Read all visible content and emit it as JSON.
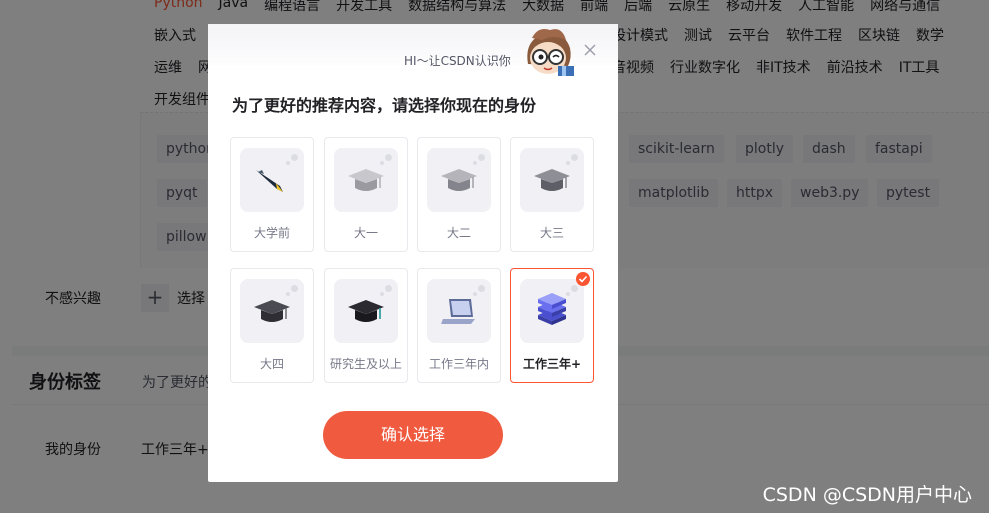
{
  "background": {
    "category_rows": [
      [
        "Python",
        "Java",
        "编程语言",
        "开发工具",
        "数据结构与算法",
        "大数据",
        "前端",
        "后端",
        "云原生",
        "移动开发",
        "人工智能",
        "网络与通信"
      ],
      [
        "嵌入式",
        "设计模式",
        "测试",
        "云平台",
        "软件工程",
        "区块链",
        "数学"
      ],
      [
        "运维",
        "网",
        "音视频",
        "行业数字化",
        "非IT技术",
        "前沿技术",
        "IT工具"
      ],
      [
        "开发组件"
      ]
    ],
    "tags_row1": [
      "python",
      "scikit-learn",
      "plotly",
      "dash",
      "fastapi"
    ],
    "tags_row2": [
      "pyqt",
      "matplotlib",
      "httpx",
      "web3.py",
      "pytest"
    ],
    "tags_row3": [
      "pillow"
    ],
    "not_interested_label": "不感兴趣",
    "select_label": "选择",
    "identity_section_title": "身份标签",
    "identity_section_sub": "为了更好的",
    "my_identity_label": "我的身份",
    "my_identity_value": "工作三年+",
    "watermark": "CSDN @CSDN用户中心"
  },
  "modal": {
    "greeting": "HI～让CSDN认识你",
    "title": "为了更好的推荐内容，请选择你现在的身份",
    "options": [
      {
        "label": "大学前",
        "icon": "pen-icon",
        "selected": false
      },
      {
        "label": "大一",
        "icon": "graduation-cap-icon",
        "selected": false
      },
      {
        "label": "大二",
        "icon": "graduation-cap-icon",
        "selected": false
      },
      {
        "label": "大三",
        "icon": "graduation-cap-icon",
        "selected": false
      },
      {
        "label": "大四",
        "icon": "graduation-cap-icon",
        "selected": false
      },
      {
        "label": "研究生及以上",
        "icon": "graduation-cap-icon",
        "selected": false
      },
      {
        "label": "工作三年内",
        "icon": "laptop-icon",
        "selected": false
      },
      {
        "label": "工作三年+",
        "icon": "stack-layers-icon",
        "selected": true
      }
    ],
    "confirm_label": "确认选择"
  },
  "colors": {
    "accent": "#fc5531",
    "button": "#f05a3e",
    "overlay": "rgba(0,0,0,0.5)"
  }
}
